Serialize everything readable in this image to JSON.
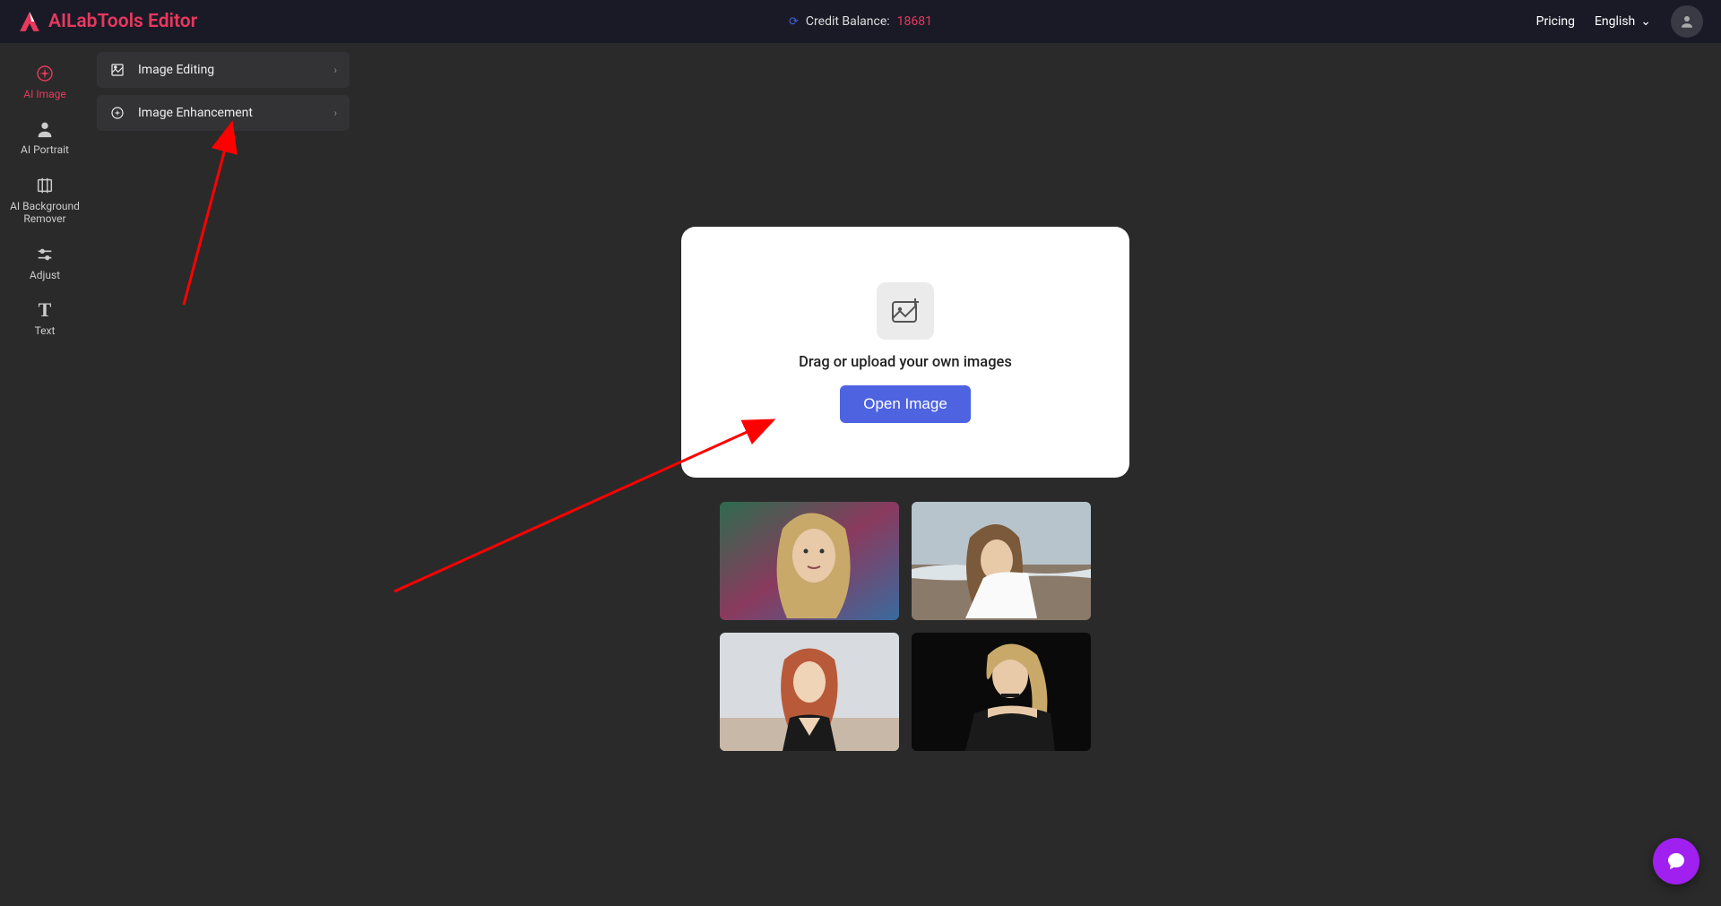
{
  "header": {
    "app_title": "AILabTools Editor",
    "credit_label": "Credit Balance:",
    "credit_value": "18681",
    "pricing": "Pricing",
    "language": "English"
  },
  "sidebar": {
    "items": [
      {
        "label": "AI Image",
        "icon": "sparkle",
        "active": true
      },
      {
        "label": "AI Portrait",
        "icon": "person",
        "active": false
      },
      {
        "label": "AI Background Remover",
        "icon": "frame",
        "active": false
      },
      {
        "label": "Adjust",
        "icon": "sliders",
        "active": false
      },
      {
        "label": "Text",
        "icon": "text",
        "active": false
      }
    ]
  },
  "submenu": {
    "items": [
      {
        "label": "Image Editing",
        "icon": "crop"
      },
      {
        "label": "Image Enhancement",
        "icon": "enhance"
      }
    ]
  },
  "upload": {
    "text": "Drag or upload your own images",
    "button_label": "Open Image"
  },
  "samples": [
    {
      "name": "sample-1"
    },
    {
      "name": "sample-2"
    },
    {
      "name": "sample-3"
    },
    {
      "name": "sample-4"
    }
  ]
}
